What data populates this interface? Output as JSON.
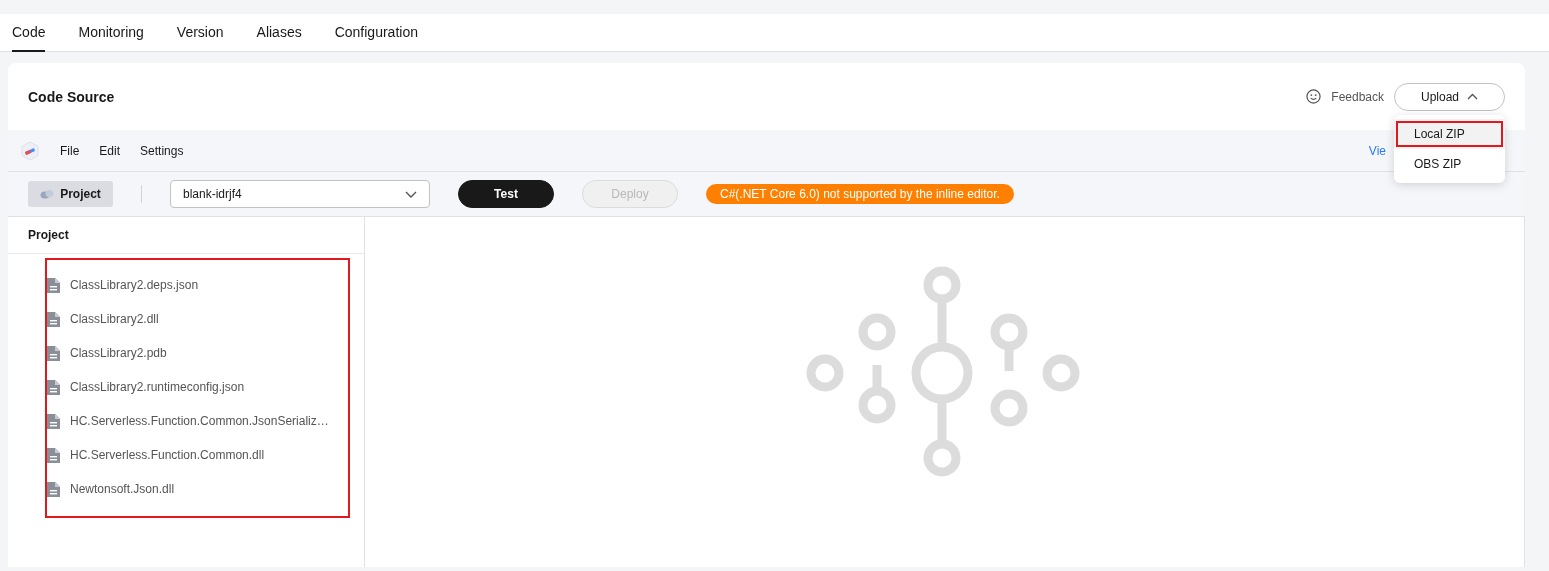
{
  "tabs": [
    {
      "label": "Code",
      "selected": true
    },
    {
      "label": "Monitoring",
      "selected": false
    },
    {
      "label": "Version",
      "selected": false
    },
    {
      "label": "Aliases",
      "selected": false
    },
    {
      "label": "Configuration",
      "selected": false
    }
  ],
  "card": {
    "title": "Code Source",
    "feedback": "Feedback",
    "upload": {
      "label": "Upload",
      "expanded": true,
      "menu": [
        {
          "label": "Local ZIP",
          "highlighted": true
        },
        {
          "label": "OBS ZIP",
          "highlighted": false
        }
      ]
    }
  },
  "editor": {
    "menu": [
      "File",
      "Edit",
      "Settings"
    ],
    "link": "Vie",
    "project_button": "Project",
    "function_select": "blank-idrjf4",
    "test": {
      "label": "Test",
      "disabled": false
    },
    "deploy": {
      "label": "Deploy",
      "disabled": true
    },
    "notice": "C#(.NET Core 6.0) not supported by the inline editor.",
    "explorer": {
      "title": "Project",
      "highlighted": true,
      "files": [
        "ClassLibrary2.deps.json",
        "ClassLibrary2.dll",
        "ClassLibrary2.pdb",
        "ClassLibrary2.runtimeconfig.json",
        "HC.Serverless.Function.Common.JsonSerializ…",
        "HC.Serverless.Function.Common.dll",
        "Newtonsoft.Json.dll"
      ]
    }
  }
}
